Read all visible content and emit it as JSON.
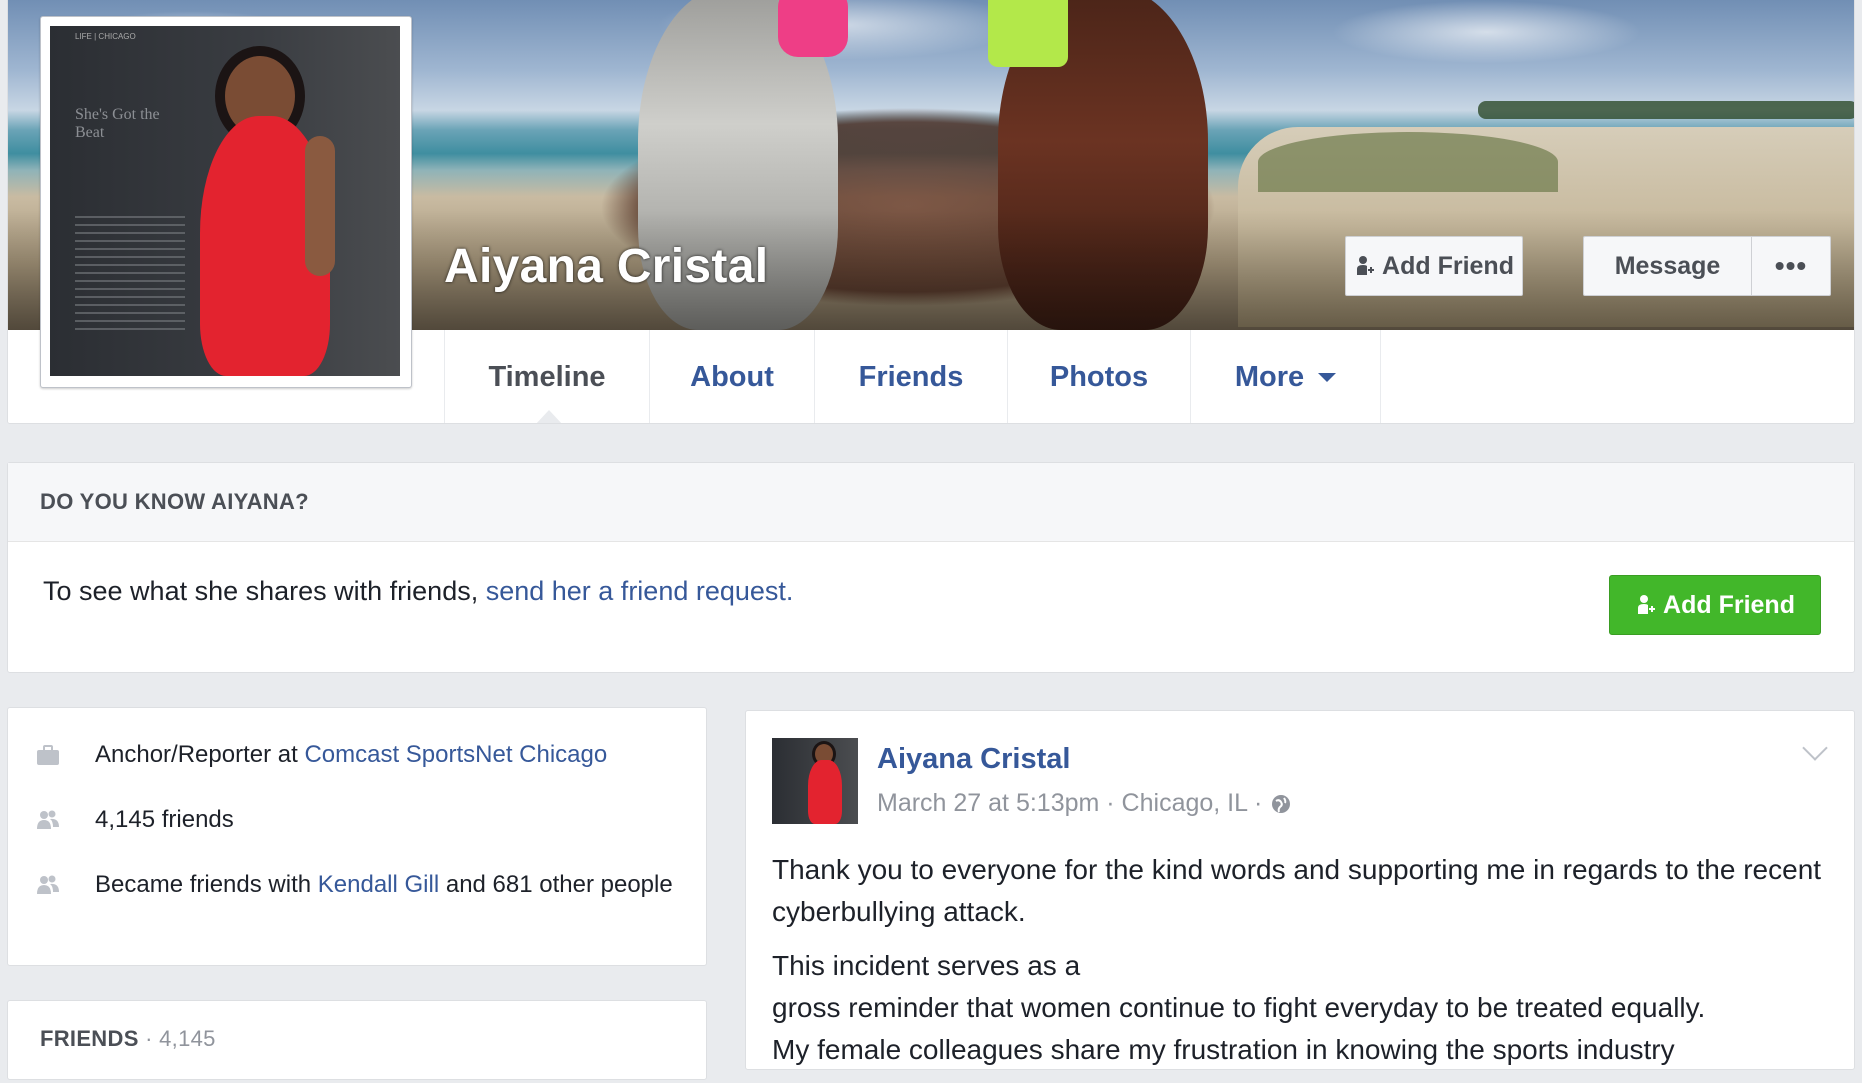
{
  "profile": {
    "name": "Aiyana Cristal",
    "cover_buttons": {
      "add_friend": "Add Friend",
      "message": "Message",
      "more": "•••"
    },
    "profile_picture_text": {
      "header": "LIFE | CHICAGO",
      "headline": "She's Got the Beat"
    }
  },
  "tabs": [
    {
      "label": "Timeline",
      "active": true
    },
    {
      "label": "About"
    },
    {
      "label": "Friends"
    },
    {
      "label": "Photos"
    },
    {
      "label": "More"
    }
  ],
  "know_prompt": {
    "heading": "DO YOU KNOW AIYANA?",
    "text_prefix": "To see what she shares with friends, ",
    "text_link": "send her a friend request.",
    "button": "Add Friend"
  },
  "intro": {
    "work_prefix": "Anchor/Reporter at ",
    "work_link": "Comcast SportsNet Chicago",
    "friends": "4,145 friends",
    "became_prefix": "Became friends with ",
    "became_link": "Kendall Gill",
    "became_suffix": " and 681 other people"
  },
  "friends_section": {
    "heading": "FRIENDS",
    "count": " · 4,145"
  },
  "post": {
    "author": "Aiyana Cristal",
    "meta": "March 27 at 5:13pm · Chicago, IL ·",
    "paragraph1": "Thank you to everyone for the kind words and supporting me in regards to the recent cyberbullying attack.",
    "paragraph2_line1": "This incident serves as a",
    "paragraph2_line2": "gross reminder that women continue to fight everyday to be treated equally.",
    "paragraph2_line3": "My female colleagues share my frustration in knowing the sports industry"
  },
  "colors": {
    "link": "#365899",
    "green_button": "#42b72a",
    "page_bg": "#e9ebee"
  },
  "icons": [
    "add-friend-icon",
    "briefcase-icon",
    "friends-icon",
    "globe-icon",
    "chevron-down-icon"
  ]
}
